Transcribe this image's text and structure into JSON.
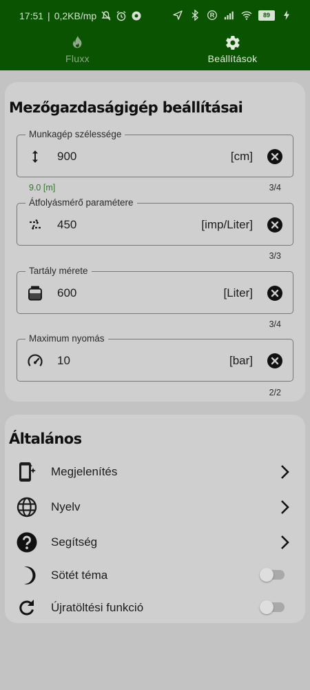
{
  "status_bar": {
    "time": "17:51",
    "separator": "|",
    "net_speed": "0,2KB/mp",
    "battery": "89"
  },
  "tabs": [
    {
      "label": "Fluxx",
      "icon": "flame-icon",
      "active": false
    },
    {
      "label": "Beállítások",
      "icon": "gear-icon",
      "active": true
    }
  ],
  "machine": {
    "title": "Mezőgazdaságigép beállításai",
    "fields": [
      {
        "label": "Munkagép szélessége",
        "icon": "vertical-arrows-icon",
        "value": "900",
        "unit": "[cm]",
        "hint": "9.0 [m]",
        "counter": "3/4"
      },
      {
        "label": "Átfolyásmérő paramétere",
        "icon": "swap-arrows-icon",
        "value": "450",
        "unit": "[imp/Liter]",
        "hint": "",
        "counter": "3/3"
      },
      {
        "label": "Tartály mérete",
        "icon": "tank-icon",
        "value": "600",
        "unit": "[Liter]",
        "hint": "",
        "counter": "3/4"
      },
      {
        "label": "Maximum nyomás",
        "icon": "gauge-icon",
        "value": "10",
        "unit": "[bar]",
        "hint": "",
        "counter": "2/2"
      }
    ]
  },
  "general": {
    "title": "Általános",
    "items": [
      {
        "label": "Megjelenítés",
        "icon": "display-settings-icon",
        "control": "chevron"
      },
      {
        "label": "Nyelv",
        "icon": "globe-icon",
        "control": "chevron"
      },
      {
        "label": "Segítség",
        "icon": "help-icon",
        "control": "chevron"
      },
      {
        "label": "Sötét téma",
        "icon": "moon-icon",
        "control": "toggle",
        "on": false
      },
      {
        "label": "Újratöltési funkció",
        "icon": "refresh-icon",
        "control": "toggle",
        "on": false
      }
    ]
  },
  "colors": {
    "header": "#0a5300",
    "hint_green": "#2c7a22",
    "card": "#cfcfcf",
    "background": "#c3c3c3"
  }
}
